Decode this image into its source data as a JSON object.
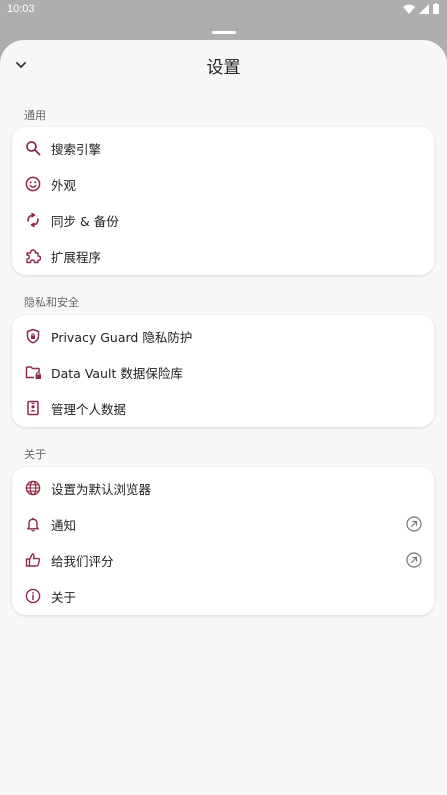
{
  "status_bar": {
    "time": "10:03"
  },
  "header": {
    "title": "设置"
  },
  "colors": {
    "accent": "#8c2d43",
    "label_gray": "#666666"
  },
  "sections": [
    {
      "label": "通用",
      "items": [
        {
          "label": "搜索引擎",
          "icon": "search-icon"
        },
        {
          "label": "外观",
          "icon": "smiley-icon"
        },
        {
          "label": "同步 & 备份",
          "icon": "sync-icon"
        },
        {
          "label": "扩展程序",
          "icon": "puzzle-icon"
        }
      ]
    },
    {
      "label": "隐私和安全",
      "items": [
        {
          "label": "Privacy Guard 隐私防护",
          "icon": "shield-icon"
        },
        {
          "label": "Data Vault 数据保险库",
          "icon": "folder-lock-icon"
        },
        {
          "label": "管理个人数据",
          "icon": "id-badge-icon"
        }
      ]
    },
    {
      "label": "关于",
      "items": [
        {
          "label": "设置为默认浏览器",
          "icon": "globe-icon"
        },
        {
          "label": "通知",
          "icon": "bell-icon",
          "trailing": "external-link-icon"
        },
        {
          "label": "给我们评分",
          "icon": "thumbs-up-icon",
          "trailing": "external-link-icon"
        },
        {
          "label": "关于",
          "icon": "info-icon"
        }
      ]
    }
  ]
}
